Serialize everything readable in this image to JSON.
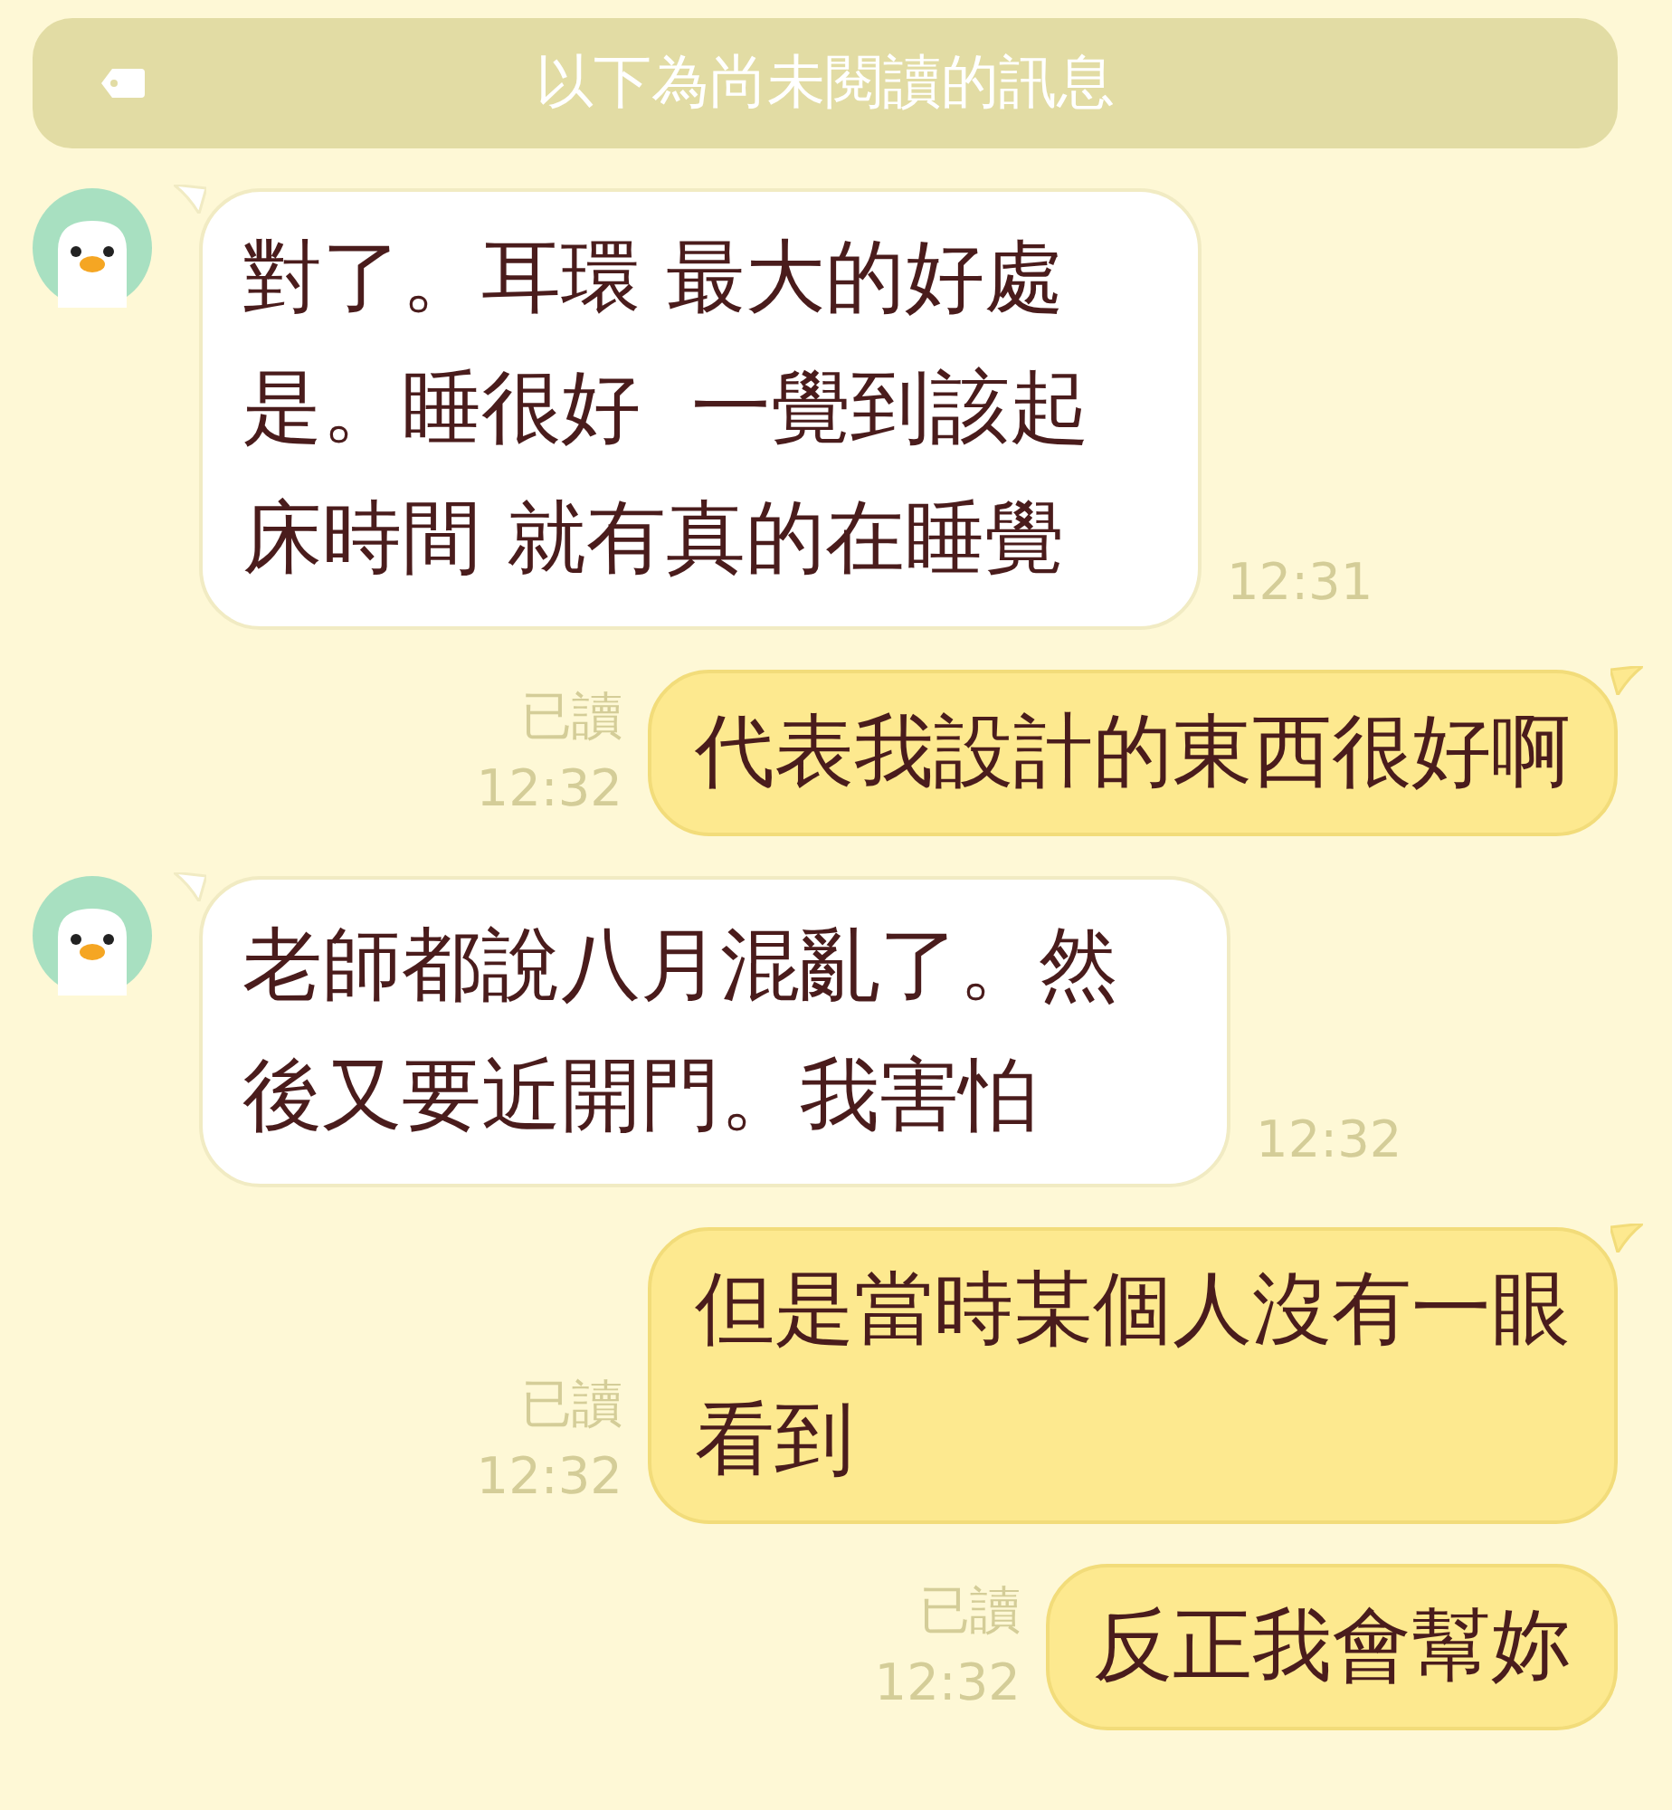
{
  "banner": {
    "text": "以下為尚未閱讀的訊息"
  },
  "messages": [
    {
      "kind": "incoming",
      "tail": true,
      "lines": [
        "對了。耳環 最大的好處",
        "是。睡很好  一覺到該起",
        "床時間 就有真的在睡覺"
      ],
      "time": "12:31"
    },
    {
      "kind": "outgoing",
      "tail": true,
      "read": "已讀",
      "lines": [
        "代表我設計的東西很好啊"
      ],
      "time": "12:32"
    },
    {
      "kind": "incoming",
      "tail": true,
      "lines": [
        "老師都說八月混亂了。然",
        "後又要近開門。我害怕"
      ],
      "time": "12:32"
    },
    {
      "kind": "outgoing",
      "tail": true,
      "read": "已讀",
      "lines": [
        "但是當時某個人沒有一眼",
        "看到"
      ],
      "time": "12:32"
    },
    {
      "kind": "outgoing",
      "tail": false,
      "read": "已讀",
      "lines": [
        "反正我會幫妳"
      ],
      "time": "12:32"
    }
  ]
}
